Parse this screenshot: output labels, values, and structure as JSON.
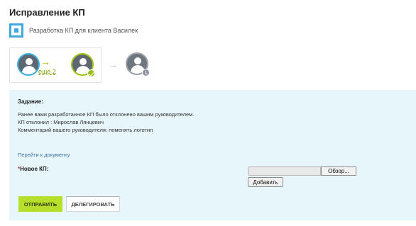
{
  "page": {
    "title": "Исправление КП"
  },
  "task": {
    "label": "Разработка КП для клиента Василек",
    "icon": "task-icon"
  },
  "workflow": {
    "more_link": "еще 2",
    "arrow_green": "→",
    "arrow_grey": "→",
    "steps": [
      {
        "icon": "user-avatar-icon",
        "status": "current"
      },
      {
        "icon": "user-avatar-icon",
        "status": "completed",
        "badge": "check-icon"
      },
      {
        "icon": "user-avatar-icon",
        "status": "pending",
        "badge": "clock-icon"
      }
    ]
  },
  "assignment": {
    "heading": "Задание:",
    "lines": [
      "Ранее вами разработанное КП было отклонено вашим руководителем.",
      "КП отклонил : Мирослав Лянцевич",
      "Комментарий вашего руководителя: поменять логотип"
    ],
    "doc_link": "Перейти к документу",
    "field_required_mark": "*",
    "field_label": "Новое КП:",
    "browse_label": "Обзор...",
    "add_label": "Добавить"
  },
  "actions": {
    "send_label": "ОТПРАВИТЬ",
    "delegate_label": "ДЕЛЕГИРОВАТЬ"
  },
  "colors": {
    "accent_green": "#b8de2c",
    "accent_blue": "#3fa9dd",
    "panel_bg": "#e6f6fb"
  }
}
